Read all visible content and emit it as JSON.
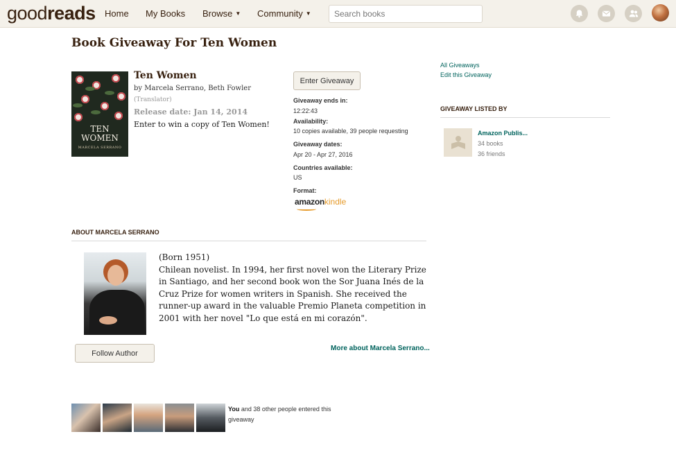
{
  "header": {
    "logo_light": "good",
    "logo_bold": "reads",
    "nav": {
      "home": "Home",
      "my_books": "My Books",
      "browse": "Browse",
      "community": "Community"
    },
    "search_placeholder": "Search books",
    "icons": [
      "bell-icon",
      "mail-icon",
      "friends-icon"
    ]
  },
  "page": {
    "title": "Book Giveaway For Ten Women"
  },
  "book": {
    "title": "Ten Women",
    "by": "by",
    "authors": "Marcela Serrano, Beth Fowler",
    "translator": "(Translator)",
    "release_date": "Release date: Jan 14, 2014",
    "win_text": "Enter to win a copy of Ten Women!",
    "cover_title_line1": "TEN",
    "cover_title_line2": "WOMEN",
    "cover_author": "MARCELA SERRANO"
  },
  "giveaway": {
    "enter_button": "Enter Giveaway",
    "ends_label": "Giveaway ends in:",
    "ends_value": "12:22:43",
    "availability_label": "Availability:",
    "availability_value": "10 copies available, 39 people requesting",
    "dates_label": "Giveaway dates:",
    "dates_value": "Apr 20 - Apr 27, 2016",
    "countries_label": "Countries available:",
    "countries_value": "US",
    "format_label": "Format:",
    "format_amazon": "amazon",
    "format_kindle": "kindle"
  },
  "sidebar": {
    "all_giveaways": "All Giveaways",
    "edit_giveaway": "Edit this Giveaway",
    "listed_by_heading": "GIVEAWAY LISTED BY",
    "publisher_name": "Amazon Publis...",
    "publisher_books": "34 books",
    "publisher_friends": "36 friends"
  },
  "about": {
    "heading": "ABOUT MARCELA SERRANO",
    "bio": "(Born 1951)\nChilean novelist. In 1994, her first novel won the Literary Prize in Santiago, and her second book won the Sor Juana Inés de la Cruz Prize for women writers in Spanish. She received the runner-up award in the valuable Premio Planeta competition in 2001 with her novel \"Lo que está en mi corazón\".",
    "follow_button": "Follow Author",
    "more_link": "More about Marcela Serrano..."
  },
  "entrants": {
    "you": "You",
    "text": " and 38 other people entered this giveaway"
  },
  "colors": {
    "header_bg": "#f4f1ea",
    "brand_brown": "#382110",
    "link_green": "#00635d",
    "kindle_orange": "#e69b2b"
  }
}
